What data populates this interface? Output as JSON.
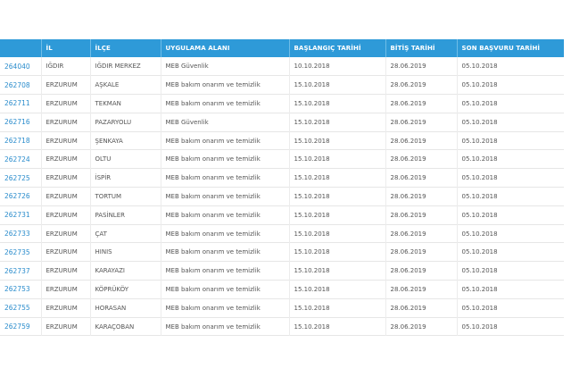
{
  "table": {
    "headers": [
      "",
      "İL",
      "İLÇE",
      "UYGULAMA ALANI",
      "BAŞLANGIÇ TARİHİ",
      "BİTİŞ TARİHİ",
      "SON BAŞVURU TARİHİ"
    ],
    "rows": [
      [
        "264040",
        "IĞDIR",
        "IĞDIR MERKEZ",
        "MEB Güvenlik",
        "10.10.2018",
        "28.06.2019",
        "05.10.2018"
      ],
      [
        "262708",
        "ERZURUM",
        "AŞKALE",
        "MEB bakım onarım ve temizlik",
        "15.10.2018",
        "28.06.2019",
        "05.10.2018"
      ],
      [
        "262711",
        "ERZURUM",
        "TEKMAN",
        "MEB bakım onarım ve temizlik",
        "15.10.2018",
        "28.06.2019",
        "05.10.2018"
      ],
      [
        "262716",
        "ERZURUM",
        "PAZARYOLU",
        "MEB Güvenlik",
        "15.10.2018",
        "28.06.2019",
        "05.10.2018"
      ],
      [
        "262718",
        "ERZURUM",
        "ŞENKAYA",
        "MEB bakım onarım ve temizlik",
        "15.10.2018",
        "28.06.2019",
        "05.10.2018"
      ],
      [
        "262724",
        "ERZURUM",
        "OLTU",
        "MEB bakım onarım ve temizlik",
        "15.10.2018",
        "28.06.2019",
        "05.10.2018"
      ],
      [
        "262725",
        "ERZURUM",
        "İSPİR",
        "MEB bakım onarım ve temizlik",
        "15.10.2018",
        "28.06.2019",
        "05.10.2018"
      ],
      [
        "262726",
        "ERZURUM",
        "TORTUM",
        "MEB bakım onarım ve temizlik",
        "15.10.2018",
        "28.06.2019",
        "05.10.2018"
      ],
      [
        "262731",
        "ERZURUM",
        "PASİNLER",
        "MEB bakım onarım ve temizlik",
        "15.10.2018",
        "28.06.2019",
        "05.10.2018"
      ],
      [
        "262733",
        "ERZURUM",
        "ÇAT",
        "MEB bakım onarım ve temizlik",
        "15.10.2018",
        "28.06.2019",
        "05.10.2018"
      ],
      [
        "262735",
        "ERZURUM",
        "HINIS",
        "MEB bakım onarım ve temizlik",
        "15.10.2018",
        "28.06.2019",
        "05.10.2018"
      ],
      [
        "262737",
        "ERZURUM",
        "KARAYAZI",
        "MEB bakım onarım ve temizlik",
        "15.10.2018",
        "28.06.2019",
        "05.10.2018"
      ],
      [
        "262753",
        "ERZURUM",
        "KÖPRÜKÖY",
        "MEB bakım onarım ve temizlik",
        "15.10.2018",
        "28.06.2019",
        "05.10.2018"
      ],
      [
        "262755",
        "ERZURUM",
        "HORASAN",
        "MEB bakım onarım ve temizlik",
        "15.10.2018",
        "28.06.2019",
        "05.10.2018"
      ],
      [
        "262759",
        "ERZURUM",
        "KARAÇOBAN",
        "MEB bakım onarım ve temizlik",
        "15.10.2018",
        "28.06.2019",
        "05.10.2018"
      ]
    ]
  },
  "colors": {
    "header_bg": "#2e9ad8",
    "header_text": "#ffffff",
    "id_link": "#2a8ccc",
    "cell_text": "#555555"
  }
}
